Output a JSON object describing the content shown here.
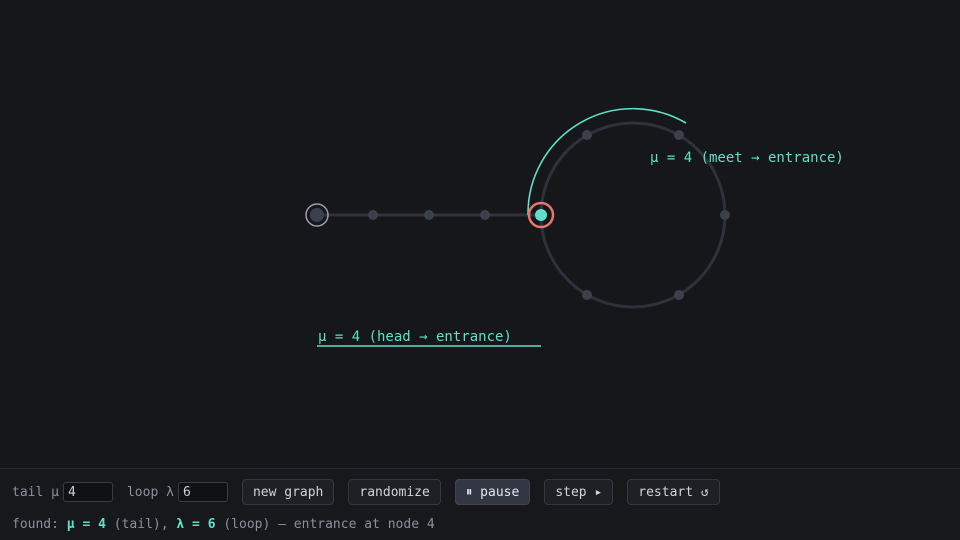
{
  "graph": {
    "mu": 4,
    "lambda": 6,
    "entrance_node": 4,
    "annotation_meet": "μ = 4 (meet → entrance)",
    "annotation_head": "μ = 4 (head → entrance)"
  },
  "controls": {
    "tail_label": "tail μ",
    "tail_value": "4",
    "loop_label": "loop λ",
    "loop_value": "6",
    "new_graph": "new graph",
    "randomize": "randomize",
    "pause": "⏸ pause",
    "step": "step ▸",
    "restart": "restart ↺"
  },
  "status": {
    "found": "found: ",
    "mu_text": "μ = 4",
    "tail": " (tail), ",
    "lambda_text": "λ = 6",
    "rest": " (loop) — entrance at node 4"
  },
  "colors": {
    "accent": "#5fe0c8",
    "node": "#3b404d",
    "edge": "#2f323a",
    "entrance_ring": "#e8766b",
    "head_ring": "#9aa0ab"
  }
}
